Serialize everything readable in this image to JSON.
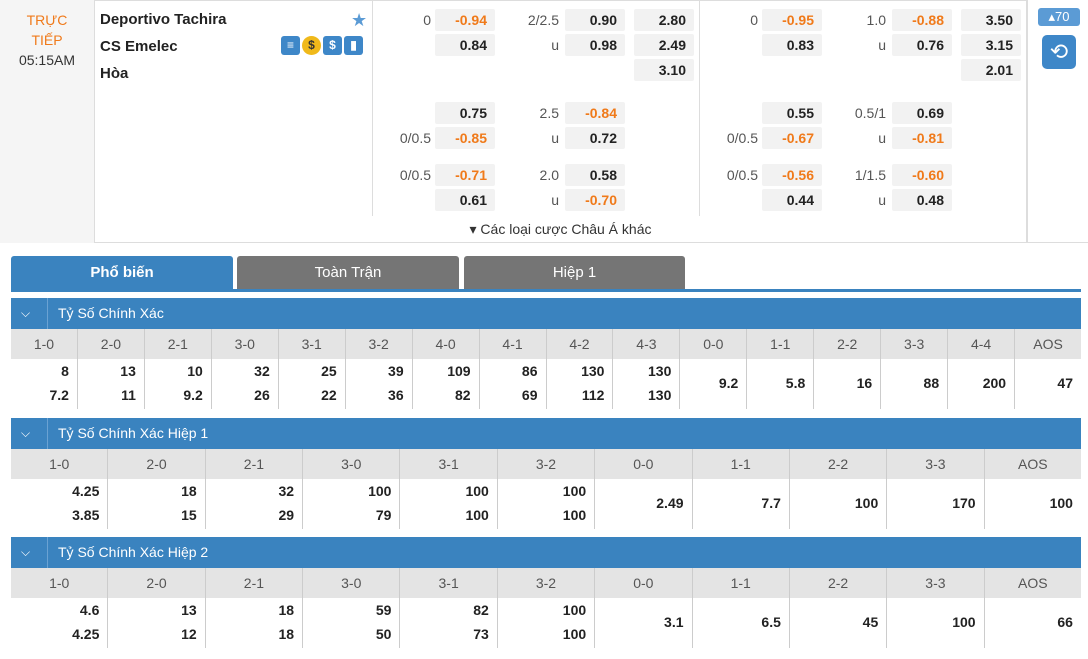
{
  "match": {
    "status_line1": "TRỰC",
    "status_line2": "TIẾP",
    "time": "05:15AM",
    "home": "Deportivo Tachira",
    "away": "CS Emelec",
    "draw": "Hòa"
  },
  "odds_left": {
    "r1": {
      "hc": "0",
      "hv1": "-0.94",
      "ou": "2/2.5",
      "ov1": "0.90",
      "x1": "2.80"
    },
    "r2": {
      "hv2": "0.84",
      "ou_u": "u",
      "ov2": "0.98",
      "x2": "2.49"
    },
    "r3": {
      "x3": "3.10"
    },
    "r4": {
      "hv1": "0.75",
      "ou": "2.5",
      "ov1": "-0.84"
    },
    "r5": {
      "hc": "0/0.5",
      "hv2": "-0.85",
      "ou_u": "u",
      "ov2": "0.72"
    },
    "r6": {
      "hc": "0/0.5",
      "hv1": "-0.71",
      "ou": "2.0",
      "ov1": "0.58"
    },
    "r7": {
      "hv2": "0.61",
      "ou_u": "u",
      "ov2": "-0.70"
    }
  },
  "odds_right": {
    "r1": {
      "hc": "0",
      "hv1": "-0.95",
      "ou": "1.0",
      "ov1": "-0.88",
      "x1": "3.50"
    },
    "r2": {
      "hv2": "0.83",
      "ou_u": "u",
      "ov2": "0.76",
      "x2": "3.15"
    },
    "r3": {
      "x3": "2.01"
    },
    "r4": {
      "hv1": "0.55",
      "ou": "0.5/1",
      "ov1": "0.69"
    },
    "r5": {
      "hc": "0/0.5",
      "hv2": "-0.67",
      "ou_u": "u",
      "ov2": "-0.81"
    },
    "r6": {
      "hc": "0/0.5",
      "hv1": "-0.56",
      "ou": "1/1.5",
      "ov1": "-0.60"
    },
    "r7": {
      "hv2": "0.44",
      "ou_u": "u",
      "ov2": "0.48"
    }
  },
  "more_label": "▾ Các loại cược Châu Á khác",
  "counter": "▴70",
  "tabs": [
    "Phổ biến",
    "Toàn Trận",
    "Hiệp 1"
  ],
  "sections": [
    {
      "title": "Tỷ Số Chính Xác",
      "cols": [
        [
          "1-0",
          "8",
          "7.2"
        ],
        [
          "2-0",
          "13",
          "11"
        ],
        [
          "2-1",
          "10",
          "9.2"
        ],
        [
          "3-0",
          "32",
          "26"
        ],
        [
          "3-1",
          "25",
          "22"
        ],
        [
          "3-2",
          "39",
          "36"
        ],
        [
          "4-0",
          "109",
          "82"
        ],
        [
          "4-1",
          "86",
          "69"
        ],
        [
          "4-2",
          "130",
          "112"
        ],
        [
          "4-3",
          "130",
          "130"
        ],
        [
          "0-0",
          "9.2"
        ],
        [
          "1-1",
          "5.8"
        ],
        [
          "2-2",
          "16"
        ],
        [
          "3-3",
          "88"
        ],
        [
          "4-4",
          "200"
        ],
        [
          "AOS",
          "47"
        ]
      ]
    },
    {
      "title": "Tỷ Số Chính Xác Hiệp 1",
      "cols": [
        [
          "1-0",
          "4.25",
          "3.85"
        ],
        [
          "2-0",
          "18",
          "15"
        ],
        [
          "2-1",
          "32",
          "29"
        ],
        [
          "3-0",
          "100",
          "79"
        ],
        [
          "3-1",
          "100",
          "100"
        ],
        [
          "3-2",
          "100",
          "100"
        ],
        [
          "0-0",
          "2.49"
        ],
        [
          "1-1",
          "7.7"
        ],
        [
          "2-2",
          "100"
        ],
        [
          "3-3",
          "170"
        ],
        [
          "AOS",
          "100"
        ]
      ]
    },
    {
      "title": "Tỷ Số Chính Xác Hiệp 2",
      "cols": [
        [
          "1-0",
          "4.6",
          "4.25"
        ],
        [
          "2-0",
          "13",
          "12"
        ],
        [
          "2-1",
          "18",
          "18"
        ],
        [
          "3-0",
          "59",
          "50"
        ],
        [
          "3-1",
          "82",
          "73"
        ],
        [
          "3-2",
          "100",
          "100"
        ],
        [
          "0-0",
          "3.1"
        ],
        [
          "1-1",
          "6.5"
        ],
        [
          "2-2",
          "45"
        ],
        [
          "3-3",
          "100"
        ],
        [
          "AOS",
          "66"
        ]
      ]
    }
  ],
  "colors": {
    "accent": "#3a83bf",
    "negative": "#f07a1a"
  }
}
